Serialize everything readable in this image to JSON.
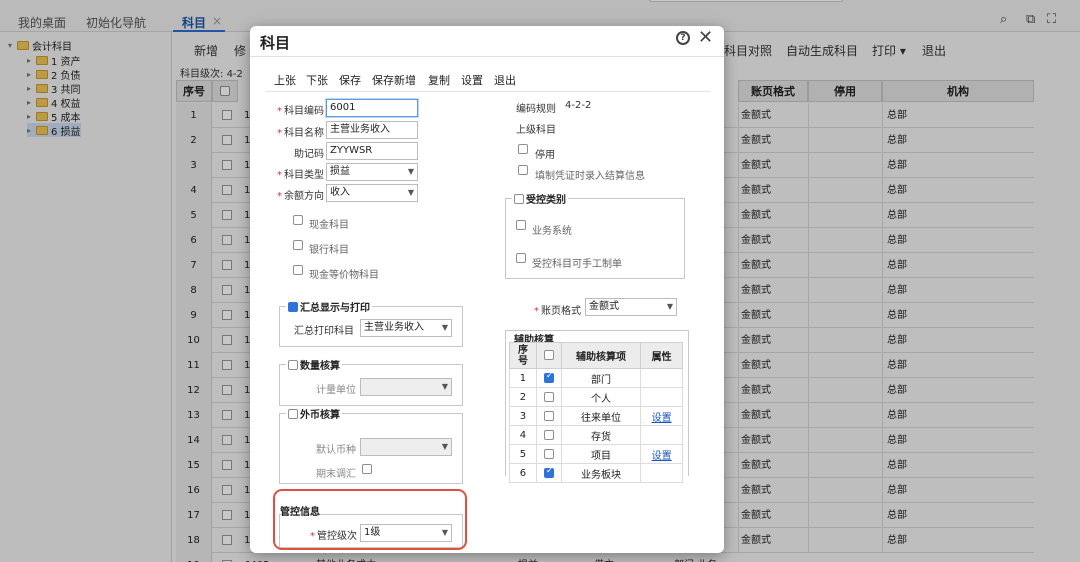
{
  "top_tabs": {
    "desktop": "我的桌面",
    "init_nav": "初始化导航",
    "subject": "科目",
    "close_glyph": "×"
  },
  "window_icons": {
    "search": "⌕",
    "restore": "⧉",
    "expand": "⛶",
    "close": "✕"
  },
  "tree": {
    "root": "会计科目",
    "items": [
      "1 资产",
      "2 负债",
      "3 共同",
      "4 权益",
      "5 成本",
      "6 损益"
    ],
    "selected_index": 5
  },
  "main_toolbar": {
    "new": "新增",
    "edit_partial": "修",
    "subject_compare": "科目对照",
    "auto_generate": "自动生成科目",
    "print": "打印",
    "exit": "退出"
  },
  "level_label": "科目级次:",
  "level_value_partial": "4-2",
  "grid": {
    "headers": {
      "seq": "序号",
      "format": "账页格式",
      "disabled": "停用",
      "org": "机构"
    },
    "row_nums": [
      "1",
      "2",
      "3",
      "4",
      "5",
      "6",
      "7",
      "8",
      "9",
      "10",
      "11",
      "12",
      "13",
      "14",
      "15",
      "16",
      "17",
      "18",
      "19"
    ],
    "row_format": "金额式",
    "row_org": "总部",
    "first_col_partial": "1",
    "last_row_code": "6402",
    "last_row_name_partial": "其他业务成本",
    "last_row_type": "损益",
    "last_row_dir": "借方",
    "last_row_aux": "部门 业务"
  },
  "dialog": {
    "title": "科目",
    "help_glyph": "?",
    "close_glyph": "✕",
    "toolbar": [
      "上张",
      "下张",
      "保存",
      "保存新增",
      "复制",
      "设置",
      "退出"
    ],
    "code_label": "科目编码",
    "code_value": "6001",
    "name_label": "科目名称",
    "name_value": "主营业务收入",
    "mnemonic_label": "助记码",
    "mnemonic_value": "ZYYWSR",
    "type_label": "科目类型",
    "type_value": "损益",
    "balance_label": "余额方向",
    "balance_value": "收入",
    "cash_label": "现金科目",
    "bank_label": "银行科目",
    "cash_eq_label": "现金等价物科目",
    "code_rule_label": "编码规则",
    "code_rule_value": "4-2-2",
    "parent_label": "上级科目",
    "disable_label": "停用",
    "settle_label": "填制凭证时录入结算信息",
    "controlled_title": "受控类别",
    "business_system": "业务系统",
    "controlled_manual": "受控科目可手工制单",
    "summary_title": "汇总显示与打印",
    "summary_print_label": "汇总打印科目",
    "summary_print_value": "主营业务收入",
    "qty_title": "数量核算",
    "unit_label": "计量单位",
    "fx_title": "外币核算",
    "currency_label": "默认币种",
    "period_end_label": "期末调汇",
    "control_info_title": "管控信息",
    "control_level_label": "管控级次",
    "control_level_value": "1级",
    "ledger_format_label": "账页格式",
    "ledger_format_value": "金额式",
    "aux_title": "辅助核算",
    "aux_headers": {
      "seq_top": "序",
      "seq_bottom": "号",
      "item": "辅助核算项",
      "attr": "属性"
    },
    "aux_rows": [
      {
        "seq": "1",
        "checked": true,
        "name": "部门",
        "attr": ""
      },
      {
        "seq": "2",
        "checked": false,
        "name": "个人",
        "attr": ""
      },
      {
        "seq": "3",
        "checked": false,
        "name": "往来单位",
        "attr": "设置"
      },
      {
        "seq": "4",
        "checked": false,
        "name": "存货",
        "attr": ""
      },
      {
        "seq": "5",
        "checked": false,
        "name": "项目",
        "attr": "设置"
      },
      {
        "seq": "6",
        "checked": true,
        "name": "业务板块",
        "attr": ""
      }
    ]
  },
  "colors": {
    "accent": "#2f73d8",
    "highlight": "#e0503f",
    "link": "#1a56c4"
  }
}
